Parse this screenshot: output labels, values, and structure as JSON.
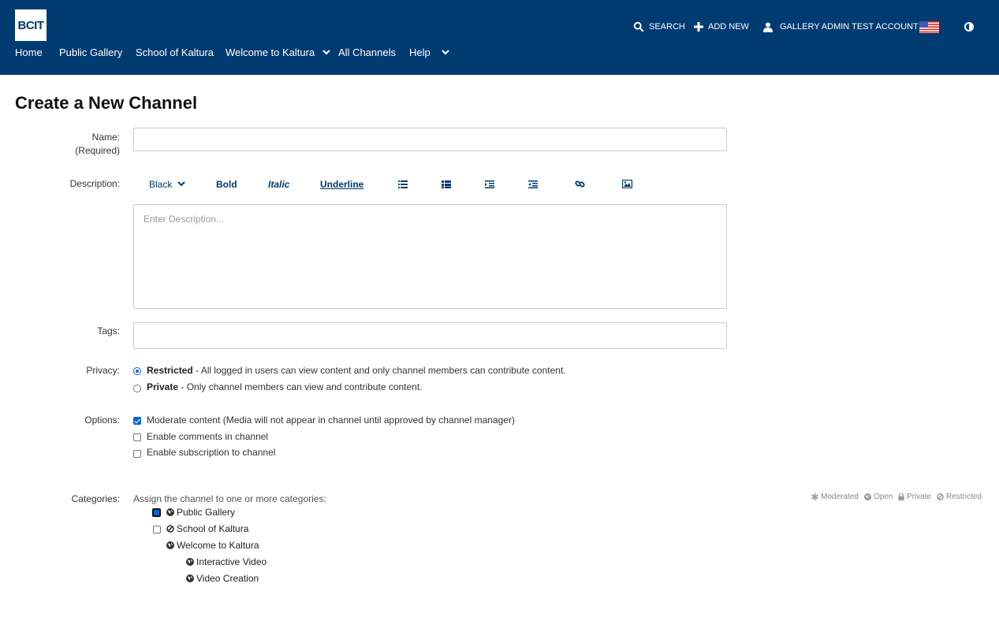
{
  "header": {
    "logo_text": "BCIT",
    "search_label": "SEARCH",
    "add_new_label": "ADD NEW",
    "account_label": "GALLERY ADMIN TEST ACCOUNT",
    "flag_icon": "us-flag-icon",
    "contrast_icon": "contrast-icon"
  },
  "nav": {
    "items": [
      "Home",
      "Public Gallery",
      "School of Kaltura",
      "Welcome to Kaltura",
      "All Channels",
      "Help"
    ]
  },
  "page": {
    "title": "Create a New Channel"
  },
  "form": {
    "name_label": "Name:",
    "name_required": "(Required)",
    "name_value": "",
    "description_label": "Description:",
    "description_placeholder": "Enter Description...",
    "toolbar": {
      "color": "Black",
      "bold": "Bold",
      "italic": "Italic",
      "underline": "Underline"
    },
    "tags_label": "Tags:",
    "privacy_label": "Privacy:",
    "privacy": {
      "restricted_title": "Restricted",
      "restricted_desc": " - All logged in users can view content and only channel members can contribute content.",
      "private_title": "Private",
      "private_desc": " - Only channel members can view and contribute content.",
      "selected": "Restricted"
    },
    "options_label": "Options:",
    "options": [
      {
        "label": "Moderate content (Media will not appear in channel until approved by channel manager)",
        "checked": true
      },
      {
        "label": "Enable comments in channel",
        "checked": false
      },
      {
        "label": "Enable subscription to channel",
        "checked": false
      }
    ],
    "categories_label": "Categories:",
    "categories_hint": "Assign the channel to one or more categories:",
    "categories": [
      {
        "label": "Public Gallery",
        "icon": "globe-icon",
        "checked": true
      },
      {
        "label": "School of Kaltura",
        "icon": "restricted-icon",
        "checked": false
      },
      {
        "label": "Welcome to Kaltura",
        "icon": "globe-icon"
      },
      {
        "label": "Interactive Video",
        "icon": "globe-icon"
      },
      {
        "label": "Video Creation",
        "icon": "globe-icon"
      }
    ],
    "legend": {
      "moderated": "Moderated",
      "open": "Open",
      "private": "Private",
      "restricted": "Restricted"
    }
  }
}
